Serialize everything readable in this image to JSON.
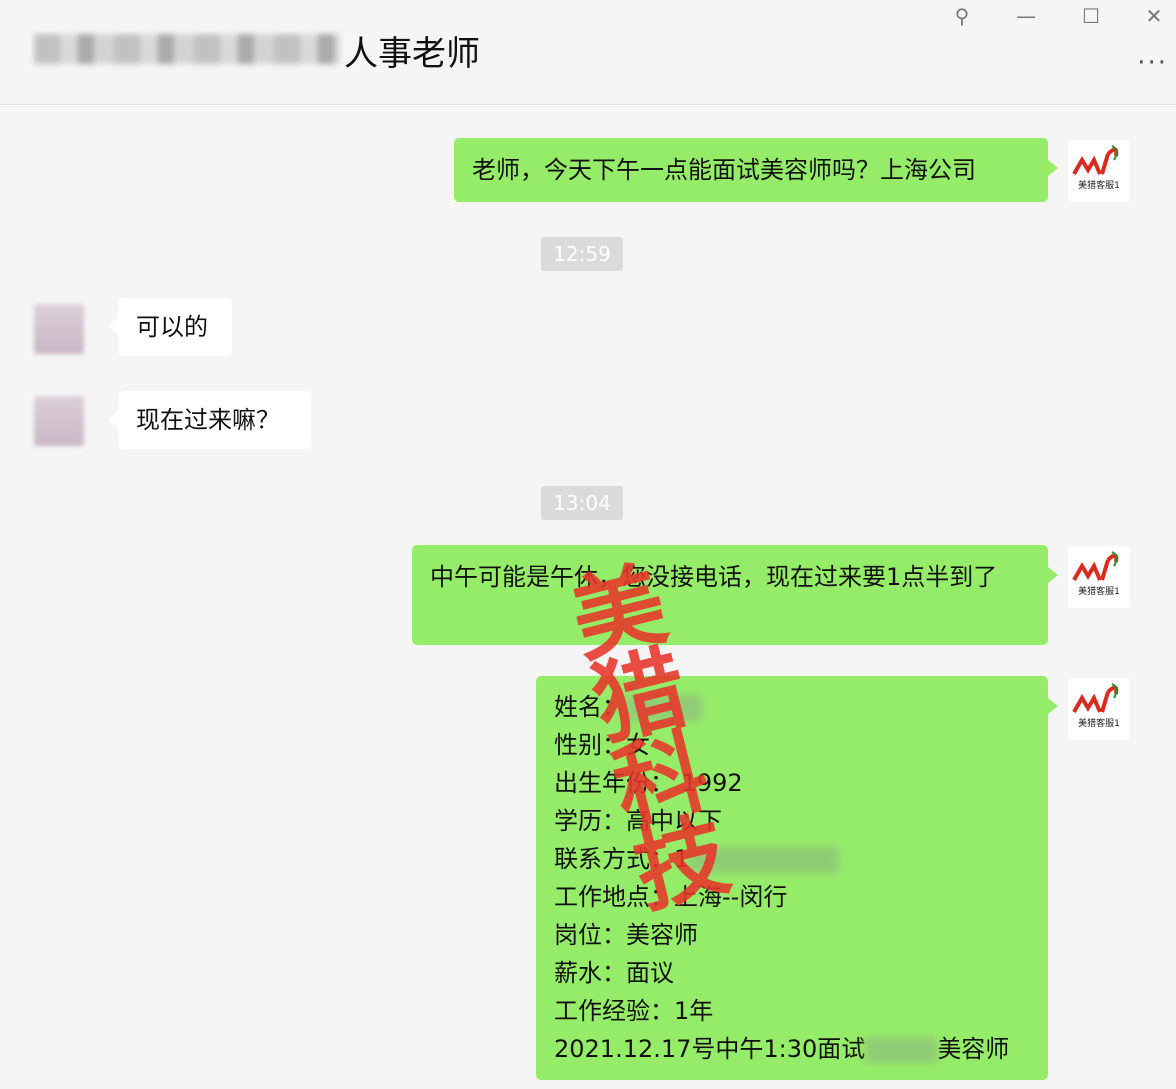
{
  "header": {
    "title": "人事老师",
    "controls": {
      "pin": "⚲",
      "minimize": "—",
      "maximize": "☐",
      "close": "✕",
      "more": "···"
    }
  },
  "logo": {
    "mark": "ML",
    "name": "美猎客服1"
  },
  "messages": {
    "m1": "老师，今天下午一点能面试美容师吗？上海公司",
    "t1": "12:59",
    "m2": "可以的",
    "m3": "现在过来嘛？",
    "t2": "13:04",
    "m4": "中午可能是午休，您没接电话，现在过来要1点半到了",
    "form": {
      "name_label": "姓名：",
      "gender_label": "性别：",
      "gender_value": "女",
      "birth": "出生年份： 1992",
      "edu": "学历：高中以下",
      "contact_label": "联系方式：",
      "contact_value": "1",
      "location": "工作地点：上海--闵行",
      "position": "岗位：美容师",
      "salary": "薪水：面议",
      "experience": "工作经验：1年",
      "schedule_prefix": "2021.12.17号中午1:30面试",
      "schedule_suffix": "美容师"
    }
  },
  "watermark": [
    "美",
    "猎",
    "科",
    "技"
  ]
}
